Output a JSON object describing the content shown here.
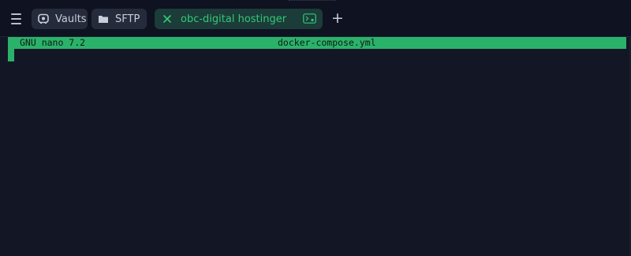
{
  "tabbar": {
    "tabs": [
      {
        "label": "Vaults",
        "icon": "vault-icon"
      },
      {
        "label": "SFTP",
        "icon": "folder-icon"
      },
      {
        "label": "obc-digital hostinger",
        "icon": "close-icon",
        "active": true,
        "status_icon": "terminal-icon"
      }
    ],
    "add_label": "+"
  },
  "terminal": {
    "header": {
      "version": "GNU nano 7.2",
      "filename": "docker-compose.yml"
    }
  },
  "colors": {
    "background": "#131725",
    "accent": "#2bb26a",
    "active_tab_bg": "#1b3c38",
    "active_tab_text": "#35c779",
    "tab_bg": "#262b3c"
  }
}
